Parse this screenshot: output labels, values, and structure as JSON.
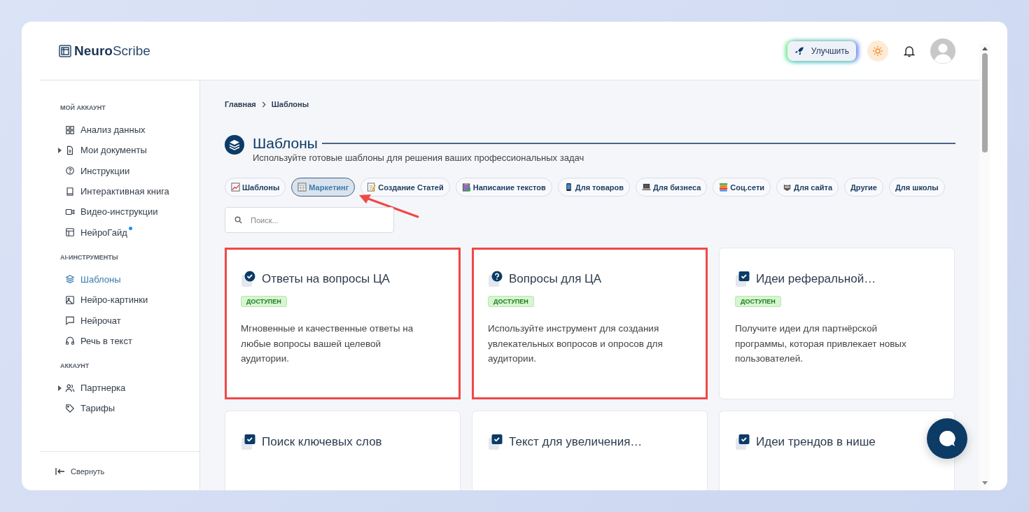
{
  "brand": {
    "bold": "Neuro",
    "light": "Scribe"
  },
  "header": {
    "upgrade_label": "Улучшить"
  },
  "sidebar": {
    "sections": [
      {
        "heading": "МОЙ АККАУНТ",
        "items": [
          {
            "label": "Анализ данных",
            "selected": false,
            "expandable": false,
            "dot": false
          },
          {
            "label": "Мои документы",
            "selected": false,
            "expandable": true,
            "dot": false
          },
          {
            "label": "Инструкции",
            "selected": false,
            "expandable": false,
            "dot": false
          },
          {
            "label": "Интерактивная книга",
            "selected": false,
            "expandable": false,
            "dot": false
          },
          {
            "label": "Видео-инструкции",
            "selected": false,
            "expandable": false,
            "dot": false
          },
          {
            "label": "НейроГайд",
            "selected": false,
            "expandable": false,
            "dot": true
          }
        ]
      },
      {
        "heading": "AI-ИНСТРУМЕНТЫ",
        "items": [
          {
            "label": "Шаблоны",
            "selected": true,
            "expandable": false,
            "dot": false
          },
          {
            "label": "Нейро-картинки",
            "selected": false,
            "expandable": false,
            "dot": false
          },
          {
            "label": "Нейрочат",
            "selected": false,
            "expandable": false,
            "dot": false
          },
          {
            "label": "Речь в текст",
            "selected": false,
            "expandable": false,
            "dot": false
          }
        ]
      },
      {
        "heading": "АККАУНТ",
        "items": [
          {
            "label": "Партнерка",
            "selected": false,
            "expandable": true,
            "dot": false
          },
          {
            "label": "Тарифы",
            "selected": false,
            "expandable": false,
            "dot": false
          }
        ]
      }
    ],
    "collapse_label": "Свернуть"
  },
  "breadcrumb": [
    "Главная",
    "Шаблоны"
  ],
  "page": {
    "title": "Шаблоны",
    "subtitle": "Используйте готовые шаблоны для решения ваших профессиональных задач"
  },
  "chips": [
    {
      "label": "Шаблоны",
      "selected": false
    },
    {
      "label": "Маркетинг",
      "selected": true
    },
    {
      "label": "Создание Статей",
      "selected": false
    },
    {
      "label": "Написание текстов",
      "selected": false
    },
    {
      "label": "Для товаров",
      "selected": false
    },
    {
      "label": "Для бизнеса",
      "selected": false
    },
    {
      "label": "Соц.сети",
      "selected": false
    },
    {
      "label": "Для сайта",
      "selected": false
    },
    {
      "label": "Другие",
      "selected": false
    },
    {
      "label": "Для школы",
      "selected": false
    }
  ],
  "annotation": {
    "arrow_to_selected_chip": true
  },
  "search": {
    "placeholder": "Поиск..."
  },
  "cards": [
    {
      "kind": "check-circle",
      "title": "Ответы на вопросы ЦА",
      "badge": "ДОСТУПЕН",
      "description": "Мгновенные и качественные ответы на любые вопросы вашей целевой аудитории.",
      "highlighted": true
    },
    {
      "kind": "question",
      "title": "Вопросы для ЦА",
      "badge": "ДОСТУПЕН",
      "description": "Используйте инструмент для создания увлекательных вопросов и опросов для аудитории.",
      "highlighted": true
    },
    {
      "kind": "check-square",
      "title": "Идеи реферальной…",
      "badge": "ДОСТУПЕН",
      "description": "Получите идеи для партнёрской программы, которая привлекает новых пользователей.",
      "highlighted": false
    },
    {
      "kind": "check-square",
      "title": "Поиск ключевых слов",
      "highlighted": false
    },
    {
      "kind": "check-square",
      "title": "Текст для увеличения…",
      "highlighted": false
    },
    {
      "kind": "check-square",
      "title": "Идеи трендов в нише",
      "highlighted": false
    }
  ]
}
